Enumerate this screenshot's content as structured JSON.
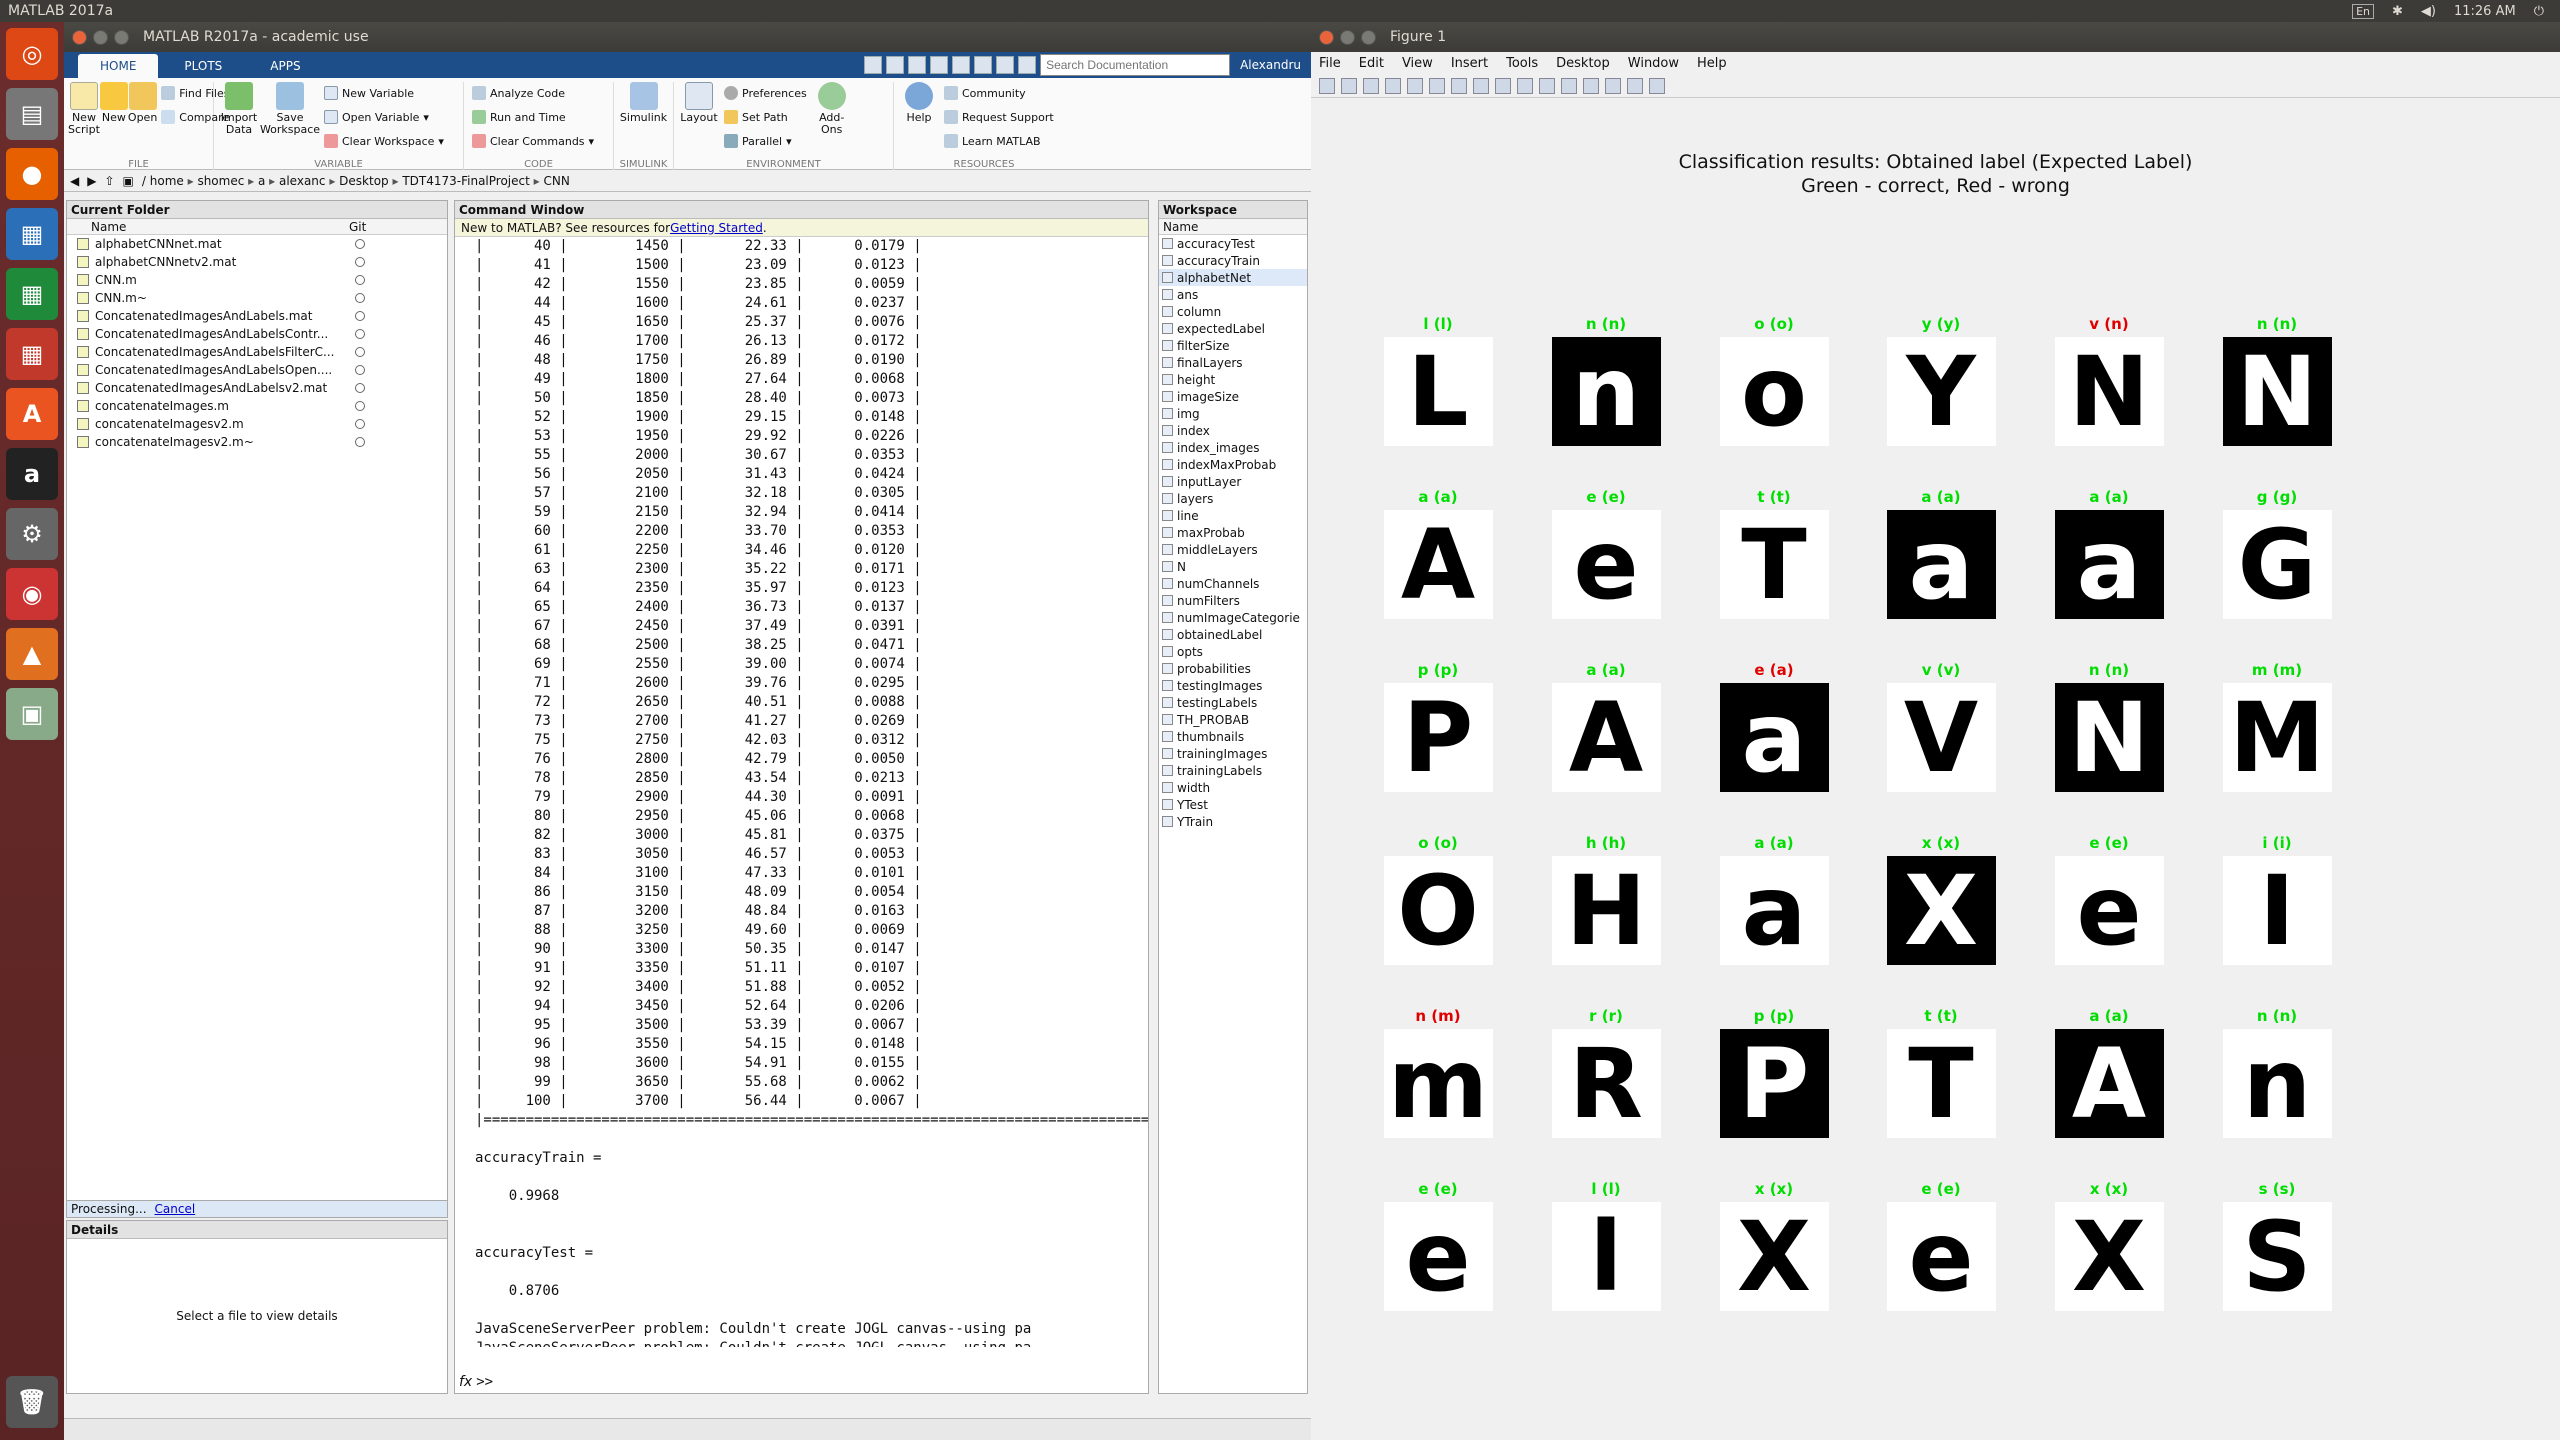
{
  "os": {
    "app_title": "MATLAB 2017a",
    "clock": "11:26 AM",
    "lang": "En",
    "launcher": [
      "ubuntu-icon",
      "files-icon",
      "firefox-icon",
      "writer-icon",
      "calc-icon",
      "impress-icon",
      "software-center-icon",
      "amazon-icon",
      "settings-icon",
      "dvd-icon",
      "matlab-icon",
      "screenshot-icon",
      "trash-icon"
    ]
  },
  "matlab": {
    "title": "MATLAB R2017a - academic use",
    "tabs": [
      "HOME",
      "PLOTS",
      "APPS"
    ],
    "search_placeholder": "Search Documentation",
    "user": "Alexandru",
    "ribbon": {
      "file": {
        "title": "FILE",
        "new_script": "New Script",
        "new": "New",
        "open": "Open",
        "find_files": "Find Files",
        "compare": "Compare"
      },
      "variable": {
        "title": "VARIABLE",
        "import": "Import Data",
        "save": "Save Workspace",
        "new_variable": "New Variable",
        "open_variable": "Open Variable",
        "clear_workspace": "Clear Workspace"
      },
      "code": {
        "title": "CODE",
        "analyze": "Analyze Code",
        "run_time": "Run and Time",
        "clear_commands": "Clear Commands"
      },
      "simulink": {
        "title": "SIMULINK",
        "simulink": "Simulink"
      },
      "environment": {
        "title": "ENVIRONMENT",
        "layout": "Layout",
        "preferences": "Preferences",
        "set_path": "Set Path",
        "parallel": "Parallel",
        "addons": "Add-Ons"
      },
      "resources": {
        "title": "RESOURCES",
        "help": "Help",
        "community": "Community",
        "request_support": "Request Support",
        "learn": "Learn MATLAB"
      }
    },
    "path": [
      "/",
      "home",
      "shomec",
      "a",
      "alexanc",
      "Desktop",
      "TDT4173-FinalProject",
      "CNN"
    ],
    "current_folder": {
      "title": "Current Folder",
      "col_name": "Name",
      "col_git": "Git",
      "files": [
        "alphabetCNNnet.mat",
        "alphabetCNNnetv2.mat",
        "CNN.m",
        "CNN.m~",
        "ConcatenatedImagesAndLabels.mat",
        "ConcatenatedImagesAndLabelsContr...",
        "ConcatenatedImagesAndLabelsFilterC...",
        "ConcatenatedImagesAndLabelsOpen....",
        "ConcatenatedImagesAndLabelsv2.mat",
        "concatenateImages.m",
        "concatenateImagesv2.m",
        "concatenateImagesv2.m~"
      ],
      "processing": "Processing...",
      "cancel": "Cancel",
      "details_title": "Details",
      "details_text": "Select a file to view details"
    },
    "command_window": {
      "title": "Command Window",
      "banner": "New to MATLAB? See resources for ",
      "banner_link": "Getting Started",
      "banner_end": ".",
      "rows": [
        [
          "40",
          "1450",
          "22.33",
          "0.0179"
        ],
        [
          "41",
          "1500",
          "23.09",
          "0.0123"
        ],
        [
          "42",
          "1550",
          "23.85",
          "0.0059"
        ],
        [
          "44",
          "1600",
          "24.61",
          "0.0237"
        ],
        [
          "45",
          "1650",
          "25.37",
          "0.0076"
        ],
        [
          "46",
          "1700",
          "26.13",
          "0.0172"
        ],
        [
          "48",
          "1750",
          "26.89",
          "0.0190"
        ],
        [
          "49",
          "1800",
          "27.64",
          "0.0068"
        ],
        [
          "50",
          "1850",
          "28.40",
          "0.0073"
        ],
        [
          "52",
          "1900",
          "29.15",
          "0.0148"
        ],
        [
          "53",
          "1950",
          "29.92",
          "0.0226"
        ],
        [
          "55",
          "2000",
          "30.67",
          "0.0353"
        ],
        [
          "56",
          "2050",
          "31.43",
          "0.0424"
        ],
        [
          "57",
          "2100",
          "32.18",
          "0.0305"
        ],
        [
          "59",
          "2150",
          "32.94",
          "0.0414"
        ],
        [
          "60",
          "2200",
          "33.70",
          "0.0353"
        ],
        [
          "61",
          "2250",
          "34.46",
          "0.0120"
        ],
        [
          "63",
          "2300",
          "35.22",
          "0.0171"
        ],
        [
          "64",
          "2350",
          "35.97",
          "0.0123"
        ],
        [
          "65",
          "2400",
          "36.73",
          "0.0137"
        ],
        [
          "67",
          "2450",
          "37.49",
          "0.0391"
        ],
        [
          "68",
          "2500",
          "38.25",
          "0.0471"
        ],
        [
          "69",
          "2550",
          "39.00",
          "0.0074"
        ],
        [
          "71",
          "2600",
          "39.76",
          "0.0295"
        ],
        [
          "72",
          "2650",
          "40.51",
          "0.0088"
        ],
        [
          "73",
          "2700",
          "41.27",
          "0.0269"
        ],
        [
          "75",
          "2750",
          "42.03",
          "0.0312"
        ],
        [
          "76",
          "2800",
          "42.79",
          "0.0050"
        ],
        [
          "78",
          "2850",
          "43.54",
          "0.0213"
        ],
        [
          "79",
          "2900",
          "44.30",
          "0.0091"
        ],
        [
          "80",
          "2950",
          "45.06",
          "0.0068"
        ],
        [
          "82",
          "3000",
          "45.81",
          "0.0375"
        ],
        [
          "83",
          "3050",
          "46.57",
          "0.0053"
        ],
        [
          "84",
          "3100",
          "47.33",
          "0.0101"
        ],
        [
          "86",
          "3150",
          "48.09",
          "0.0054"
        ],
        [
          "87",
          "3200",
          "48.84",
          "0.0163"
        ],
        [
          "88",
          "3250",
          "49.60",
          "0.0069"
        ],
        [
          "90",
          "3300",
          "50.35",
          "0.0147"
        ],
        [
          "91",
          "3350",
          "51.11",
          "0.0107"
        ],
        [
          "92",
          "3400",
          "51.88",
          "0.0052"
        ],
        [
          "94",
          "3450",
          "52.64",
          "0.0206"
        ],
        [
          "95",
          "3500",
          "53.39",
          "0.0067"
        ],
        [
          "96",
          "3550",
          "54.15",
          "0.0148"
        ],
        [
          "98",
          "3600",
          "54.91",
          "0.0155"
        ],
        [
          "99",
          "3650",
          "55.68",
          "0.0062"
        ],
        [
          "100",
          "3700",
          "56.44",
          "0.0067"
        ]
      ],
      "separator": "|================================================================================================|",
      "acc_train_label": "accuracyTrain =",
      "acc_train": "0.9968",
      "acc_test_label": "accuracyTest =",
      "acc_test": "0.8706",
      "warnings": [
        "JavaSceneServerPeer problem: Couldn't create JOGL canvas--using pa",
        "JavaSceneServerPeer problem: Couldn't create JOGL canvas--using pa",
        "JavaSceneServerPeer problem: Couldn't create JOGL canvas--using pa"
      ],
      "prompt": ">>",
      "fx": "fx"
    },
    "workspace": {
      "title": "Workspace",
      "col_name": "Name",
      "vars": [
        "accuracyTest",
        "accuracyTrain",
        "alphabetNet",
        "ans",
        "column",
        "expectedLabel",
        "filterSize",
        "finalLayers",
        "height",
        "imageSize",
        "img",
        "index",
        "index_images",
        "indexMaxProbab",
        "inputLayer",
        "layers",
        "line",
        "maxProbab",
        "middleLayers",
        "N",
        "numChannels",
        "numFilters",
        "numImageCategorie",
        "obtainedLabel",
        "opts",
        "probabilities",
        "testingImages",
        "testingLabels",
        "TH_PROBAB",
        "thumbnails",
        "trainingImages",
        "trainingLabels",
        "width",
        "YTest",
        "YTrain"
      ],
      "selected": "alphabetNet"
    }
  },
  "figure": {
    "title": "Figure 1",
    "menu": [
      "File",
      "Edit",
      "View",
      "Insert",
      "Tools",
      "Desktop",
      "Window",
      "Help"
    ],
    "plot_title_1": "Classification results: Obtained label (Expected Label)",
    "plot_title_2": "Green - correct, Red - wrong",
    "colors": {
      "correct": "#00dd00",
      "wrong": "#e00000"
    },
    "cells": [
      {
        "label": "l (l)",
        "ok": true,
        "glyph": "L",
        "inv": false
      },
      {
        "label": "n (n)",
        "ok": true,
        "glyph": "n",
        "inv": true
      },
      {
        "label": "o (o)",
        "ok": true,
        "glyph": "o",
        "inv": false
      },
      {
        "label": "y (y)",
        "ok": true,
        "glyph": "Y",
        "inv": false
      },
      {
        "label": "v (n)",
        "ok": false,
        "glyph": "N",
        "inv": false
      },
      {
        "label": "n (n)",
        "ok": true,
        "glyph": "N",
        "inv": true
      },
      {
        "label": "a (a)",
        "ok": true,
        "glyph": "A",
        "inv": false
      },
      {
        "label": "e (e)",
        "ok": true,
        "glyph": "e",
        "inv": false
      },
      {
        "label": "t (t)",
        "ok": true,
        "glyph": "T",
        "inv": false
      },
      {
        "label": "a (a)",
        "ok": true,
        "glyph": "a",
        "inv": true
      },
      {
        "label": "a (a)",
        "ok": true,
        "glyph": "a",
        "inv": true
      },
      {
        "label": "g (g)",
        "ok": true,
        "glyph": "G",
        "inv": false
      },
      {
        "label": "p (p)",
        "ok": true,
        "glyph": "P",
        "inv": false
      },
      {
        "label": "a (a)",
        "ok": true,
        "glyph": "A",
        "inv": false
      },
      {
        "label": "e (a)",
        "ok": false,
        "glyph": "a",
        "inv": true
      },
      {
        "label": "v (v)",
        "ok": true,
        "glyph": "V",
        "inv": false
      },
      {
        "label": "n (n)",
        "ok": true,
        "glyph": "N",
        "inv": true
      },
      {
        "label": "m (m)",
        "ok": true,
        "glyph": "M",
        "inv": false
      },
      {
        "label": "o (o)",
        "ok": true,
        "glyph": "O",
        "inv": false
      },
      {
        "label": "h (h)",
        "ok": true,
        "glyph": "H",
        "inv": false
      },
      {
        "label": "a (a)",
        "ok": true,
        "glyph": "a",
        "inv": false
      },
      {
        "label": "x (x)",
        "ok": true,
        "glyph": "X",
        "inv": true
      },
      {
        "label": "e (e)",
        "ok": true,
        "glyph": "e",
        "inv": false
      },
      {
        "label": "i (i)",
        "ok": true,
        "glyph": "I",
        "inv": false
      },
      {
        "label": "n (m)",
        "ok": false,
        "glyph": "m",
        "inv": false
      },
      {
        "label": "r (r)",
        "ok": true,
        "glyph": "R",
        "inv": false
      },
      {
        "label": "p (p)",
        "ok": true,
        "glyph": "P",
        "inv": true
      },
      {
        "label": "t (t)",
        "ok": true,
        "glyph": "T",
        "inv": false
      },
      {
        "label": "a (a)",
        "ok": true,
        "glyph": "A",
        "inv": true
      },
      {
        "label": "n (n)",
        "ok": true,
        "glyph": "n",
        "inv": false
      },
      {
        "label": "e (e)",
        "ok": true,
        "glyph": "e",
        "inv": false
      },
      {
        "label": "l (l)",
        "ok": true,
        "glyph": "l",
        "inv": false
      },
      {
        "label": "x (x)",
        "ok": true,
        "glyph": "X",
        "inv": false
      },
      {
        "label": "e (e)",
        "ok": true,
        "glyph": "e",
        "inv": false
      },
      {
        "label": "x (x)",
        "ok": true,
        "glyph": "X",
        "inv": false
      },
      {
        "label": "s (s)",
        "ok": true,
        "glyph": "S",
        "inv": false
      }
    ]
  }
}
